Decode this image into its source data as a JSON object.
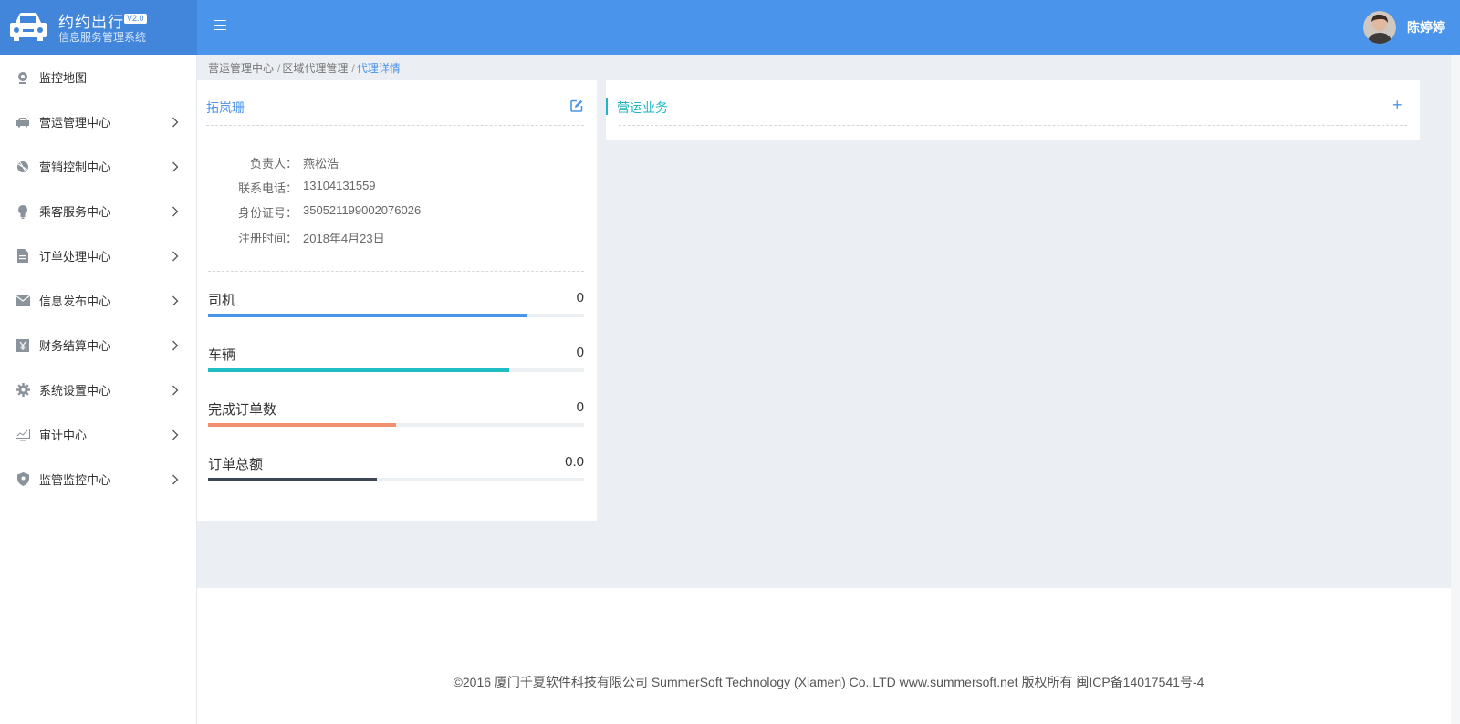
{
  "header": {
    "brand_title": "约约出行",
    "version": "V2.0",
    "brand_subtitle": "信息服务管理系统",
    "user_name": "陈婷婷"
  },
  "sidebar": {
    "items": [
      {
        "label": "监控地图",
        "icon": "map-pin-icon"
      },
      {
        "label": "营运管理中心",
        "icon": "car-icon"
      },
      {
        "label": "营销控制中心",
        "icon": "ball-icon"
      },
      {
        "label": "乘客服务中心",
        "icon": "lightbulb-icon"
      },
      {
        "label": "订单处理中心",
        "icon": "document-icon"
      },
      {
        "label": "信息发布中心",
        "icon": "envelope-icon"
      },
      {
        "label": "财务结算中心",
        "icon": "yen-box-icon"
      },
      {
        "label": "系统设置中心",
        "icon": "gear-icon"
      },
      {
        "label": "审计中心",
        "icon": "monitor-chart-icon"
      },
      {
        "label": "监管监控中心",
        "icon": "shield-pin-icon"
      }
    ]
  },
  "breadcrumb": {
    "level1": "营运管理中心",
    "level2": "区域代理管理",
    "current": "代理详情",
    "separator": "/"
  },
  "agent": {
    "name": "拓岚珊",
    "fields": [
      {
        "key": "负责人：",
        "value": "燕松浩"
      },
      {
        "key": "联系电话：",
        "value": "13104131559"
      },
      {
        "key": "身份证号：",
        "value": "350521199002076026"
      },
      {
        "key": "注册时间：",
        "value": "2018年4月23日"
      }
    ]
  },
  "stats": [
    {
      "name": "司机",
      "value": "0",
      "fill_percent": 85,
      "color": "#4a94ec"
    },
    {
      "name": "车辆",
      "value": "0",
      "fill_percent": 80,
      "color": "#1fbcc4"
    },
    {
      "name": "完成订单数",
      "value": "0",
      "fill_percent": 50,
      "color": "#f0906e"
    },
    {
      "name": "订单总额",
      "value": "0.0",
      "fill_percent": 45,
      "color": "#3d4756"
    }
  ],
  "business": {
    "title": "营运业务",
    "add_symbol": "+"
  },
  "footer": {
    "text": "©2016 厦门千夏软件科技有限公司 SummerSoft Technology (Xiamen) Co.,LTD www.summersoft.net 版权所有 闽ICP备14017541号-4"
  },
  "colors": {
    "header_bg": "#4a94ec",
    "brand_bg": "#4286dc",
    "accent": "#4a94ec",
    "teal": "#1fb5c4",
    "content_bg": "#ebeef2"
  }
}
